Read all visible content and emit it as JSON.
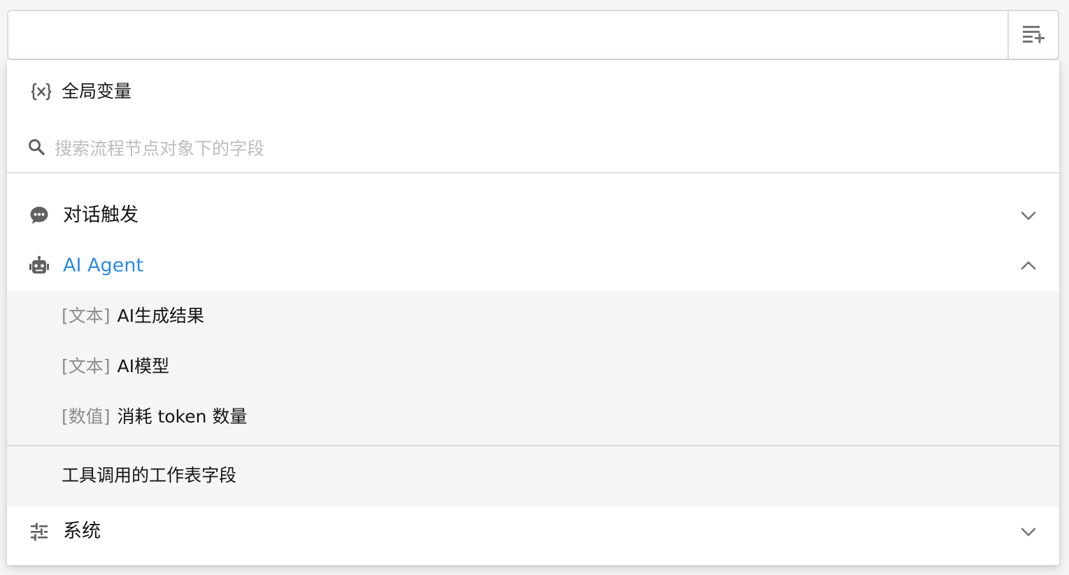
{
  "field": {
    "value": "",
    "action_icon": "playlist-add-icon"
  },
  "dropdown": {
    "global_variables": {
      "icon": "variable-braces-icon",
      "label": "全局变量"
    },
    "search": {
      "icon": "search-icon",
      "placeholder": "搜索流程节点对象下的字段",
      "value": ""
    },
    "groups": [
      {
        "id": "chat-trigger",
        "icon": "chat-bubble-icon",
        "label": "对话触发",
        "expanded": false
      },
      {
        "id": "ai-agent",
        "icon": "robot-icon",
        "label": "AI Agent",
        "expanded": true,
        "items": [
          {
            "type": "[文本]",
            "label": "AI生成结果"
          },
          {
            "type": "[文本]",
            "label": "AI模型"
          },
          {
            "type": "[数值]",
            "label": "消耗 token 数量"
          }
        ],
        "footer_item": "工具调用的工作表字段"
      },
      {
        "id": "system",
        "icon": "tune-sliders-icon",
        "label": "系统",
        "expanded": false
      }
    ]
  },
  "colors": {
    "accent": "#2e8be0",
    "text": "#151515",
    "muted": "#8c8c8c",
    "placeholder": "#bdbdbd",
    "icon": "#616161",
    "sub_background": "#f5f5f5"
  }
}
